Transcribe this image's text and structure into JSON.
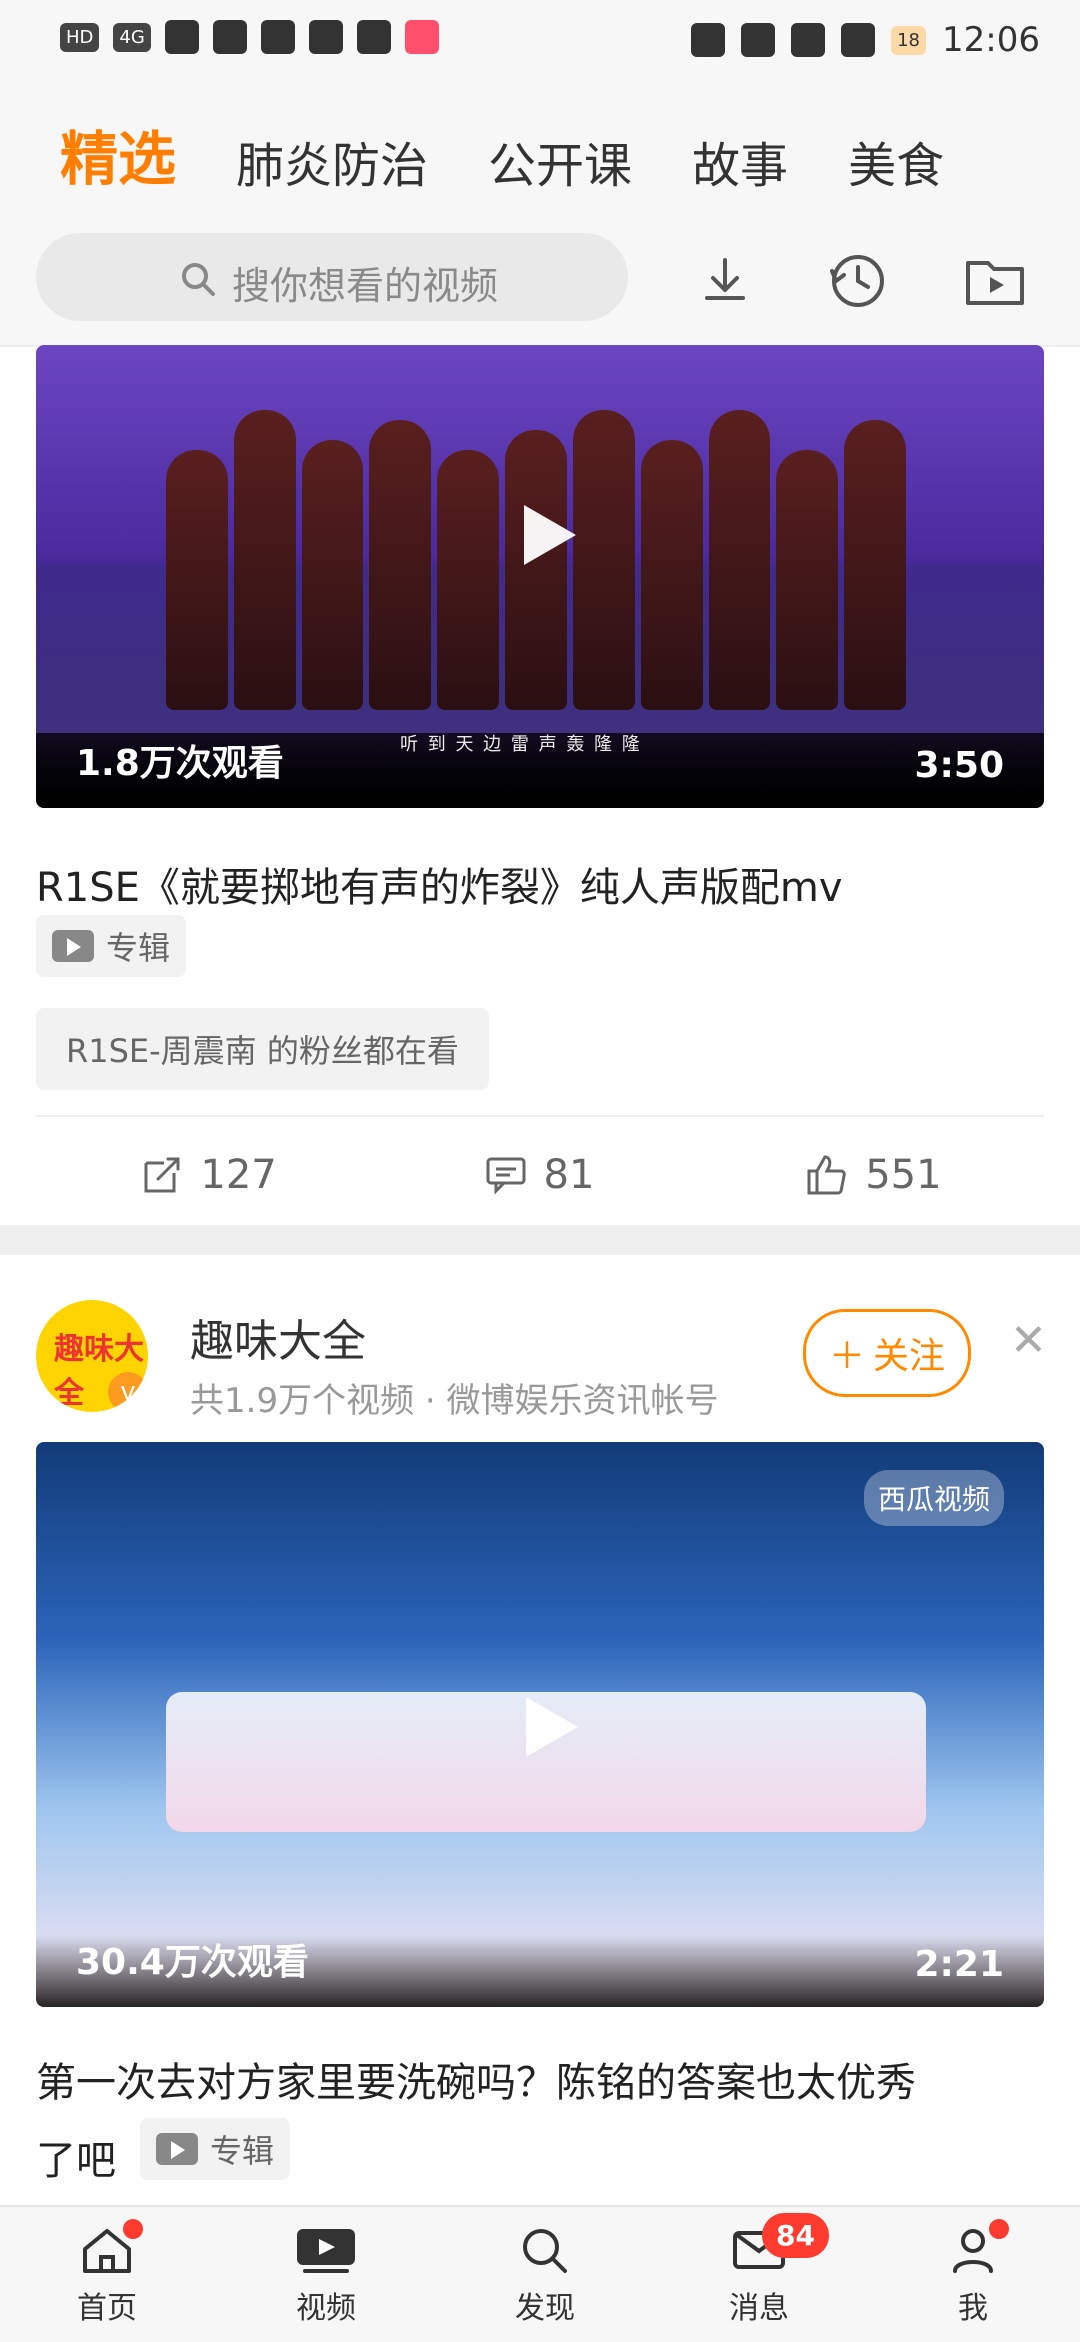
{
  "status": {
    "left_icons": [
      "HD",
      "4G",
      "signal",
      "wifi",
      "eye",
      "shield",
      "qq",
      "game"
    ],
    "battery": "18",
    "time": "12:06",
    "right_icons": [
      "nfc",
      "alarm",
      "bluetooth",
      "mute"
    ]
  },
  "tabs": [
    "精选",
    "肺炎防治",
    "公开课",
    "故事",
    "美食"
  ],
  "search": {
    "placeholder": "搜你想看的视频"
  },
  "toolbar": {
    "download": "download-icon",
    "history": "history-icon",
    "folder": "video-folder-icon"
  },
  "card1": {
    "views": "1.8万次观看",
    "duration": "3:50",
    "subtitle": "听 到 天 边 雷 声 轰 隆 隆",
    "title": "R1SE《就要掷地有声的炸裂》纯人声版配mv",
    "tag": "专辑",
    "pill": "R1SE-周震南 的粉丝都在看",
    "share": "127",
    "comments": "81",
    "likes": "551"
  },
  "account": {
    "name": "趣味大全",
    "sub": "共1.9万个视频 · 微博娱乐资讯帐号",
    "follow": "关注",
    "avatar_text": "趣味大全",
    "verified": "v"
  },
  "card2": {
    "views": "30.4万次观看",
    "duration": "2:21",
    "title_line1": "第一次去对方家里要洗碗吗？陈铭的答案也太优秀",
    "title_line2": "了吧",
    "tag": "专辑",
    "overlay_text": "西瓜视频"
  },
  "bottom_nav": [
    "首页",
    "视频",
    "发现",
    "消息",
    "我"
  ],
  "badges": {
    "messages": "84"
  },
  "colors": {
    "accent": "#ff7e00",
    "red": "#ff3b30"
  }
}
